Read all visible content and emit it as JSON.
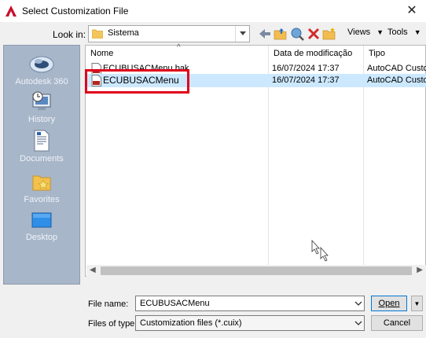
{
  "window": {
    "title": "Select Customization File"
  },
  "toolbar": {
    "look_in_label": "Look in:",
    "look_in_value": "Sistema",
    "views_label": "Views",
    "tools_label": "Tools"
  },
  "places": [
    {
      "label": "Autodesk 360",
      "icon": "cloud-icon"
    },
    {
      "label": "History",
      "icon": "history-icon"
    },
    {
      "label": "Documents",
      "icon": "documents-icon"
    },
    {
      "label": "Favorites",
      "icon": "favorites-icon"
    },
    {
      "label": "Desktop",
      "icon": "desktop-icon"
    }
  ],
  "file_list": {
    "columns": [
      "Nome",
      "Data de modificação",
      "Tipo"
    ],
    "rows": [
      {
        "name": "ECUBUSACMenu.bak",
        "date": "16/07/2024 17:37",
        "type": "AutoCAD Custom",
        "selected": false
      },
      {
        "name": "ECUBUSACMenu",
        "date": "16/07/2024 17:37",
        "type": "AutoCAD Custom",
        "selected": true
      }
    ]
  },
  "form": {
    "file_name_label": "File name:",
    "file_name_value": "ECUBUSACMenu",
    "file_type_label": "Files of type:",
    "file_type_value": "Customization files (*.cuix)",
    "open_label": "Open",
    "cancel_label": "Cancel"
  },
  "colors": {
    "highlight": "#e0001a",
    "selection": "#cce8ff",
    "places_bg": "#a8b6c9"
  }
}
